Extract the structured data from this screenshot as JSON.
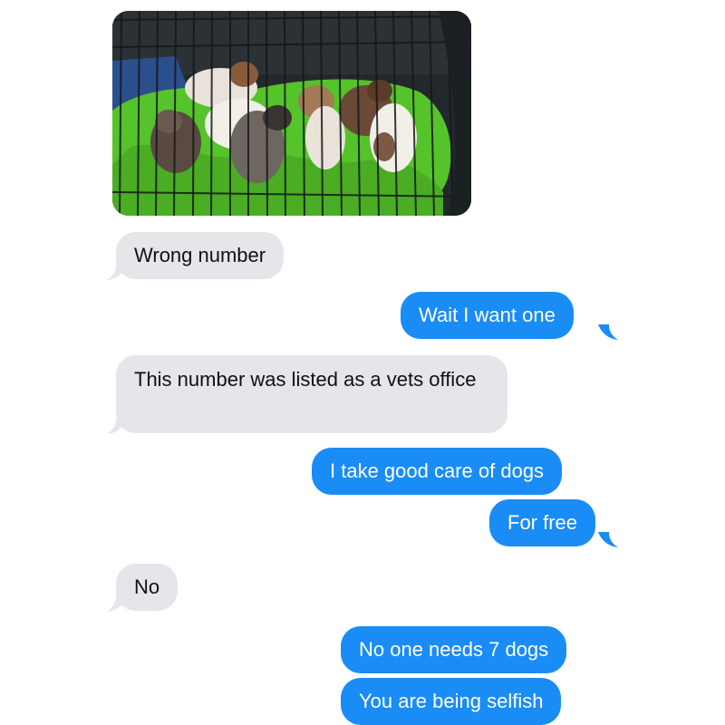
{
  "conversation": {
    "photo": {
      "description_icon": "puppies-in-crate-photo"
    },
    "messages": [
      {
        "sender": "them",
        "text": "Wrong number"
      },
      {
        "sender": "me",
        "text": "Wait I want one"
      },
      {
        "sender": "them",
        "text": "This number was listed as a vets office"
      },
      {
        "sender": "me",
        "text": "I take good care of dogs"
      },
      {
        "sender": "me",
        "text": "For free"
      },
      {
        "sender": "them",
        "text": "No"
      },
      {
        "sender": "me",
        "text": "No one needs 7 dogs"
      },
      {
        "sender": "me",
        "text": "You are being selfish"
      }
    ]
  },
  "colors": {
    "incoming_bubble": "#e5e5ea",
    "outgoing_bubble": "#1a8cf5",
    "outgoing_text": "#ffffff",
    "incoming_text": "#111111"
  }
}
